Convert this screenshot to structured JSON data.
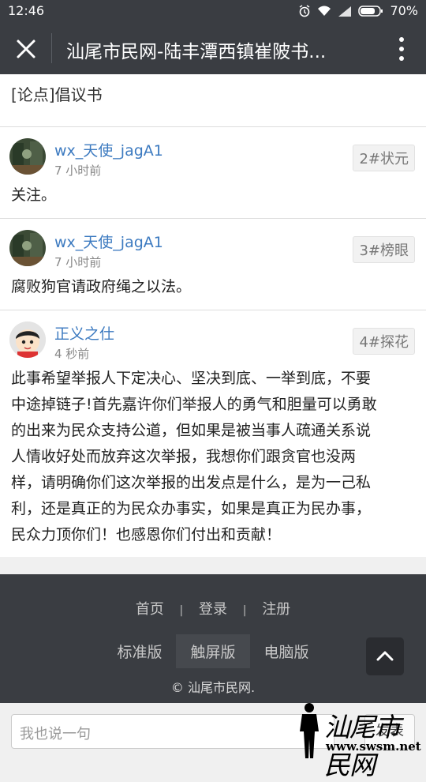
{
  "status_bar": {
    "time": "12:46",
    "battery": "70%"
  },
  "title_bar": {
    "title": "汕尾市民网-陆丰潭西镇崔陂书..."
  },
  "topic": {
    "text": "[论点]倡议书"
  },
  "posts": [
    {
      "user": "wx_天使_jagA1",
      "time": "7 小时前",
      "floor": "2#状元",
      "body": [
        "关注。"
      ]
    },
    {
      "user": "wx_天使_jagA1",
      "time": "7 小时前",
      "floor": "3#榜眼",
      "body": [
        "腐败狗官请政府绳之以法。"
      ]
    },
    {
      "user": "正义之仕",
      "time": "4 秒前",
      "floor": "4#探花",
      "body": [
        "此事希望举报人下定决心、坚决到底、一举到底，不要",
        "中途掉链子!首先嘉许你们举报人的勇气和胆量可以勇敢",
        "的出来为民众支持公道，但如果是被当事人疏通关系说",
        "人情收好处而放弃这次举报，我想你们跟贪官也没两",
        "样，请明确你们这次举报的出发点是什么，是为一己私",
        "利，还是真正的为民众办事实，如果是真正为民办事，",
        "民众力顶你们！也感恩你们付出和贡献！"
      ]
    }
  ],
  "footer": {
    "nav": [
      "首页",
      "登录",
      "注册"
    ],
    "separator": "|",
    "versions": [
      "标准版",
      "触屏版",
      "电脑版"
    ],
    "copyright": "© 汕尾市民网."
  },
  "input": {
    "placeholder": "我也说一句",
    "send_label": "发表"
  },
  "watermark": {
    "logo": "汕尾市民网",
    "url": "www.swsm.net"
  },
  "icons": {
    "close": "close-icon",
    "more": "more-vertical-icon",
    "back_to_top": "chevron-up-icon",
    "alarm": "alarm-icon",
    "wifi": "wifi-icon",
    "signal": "signal-icon",
    "battery": "battery-icon"
  },
  "colors": {
    "bar": "#3a3d42",
    "username": "#3c7ac0"
  }
}
